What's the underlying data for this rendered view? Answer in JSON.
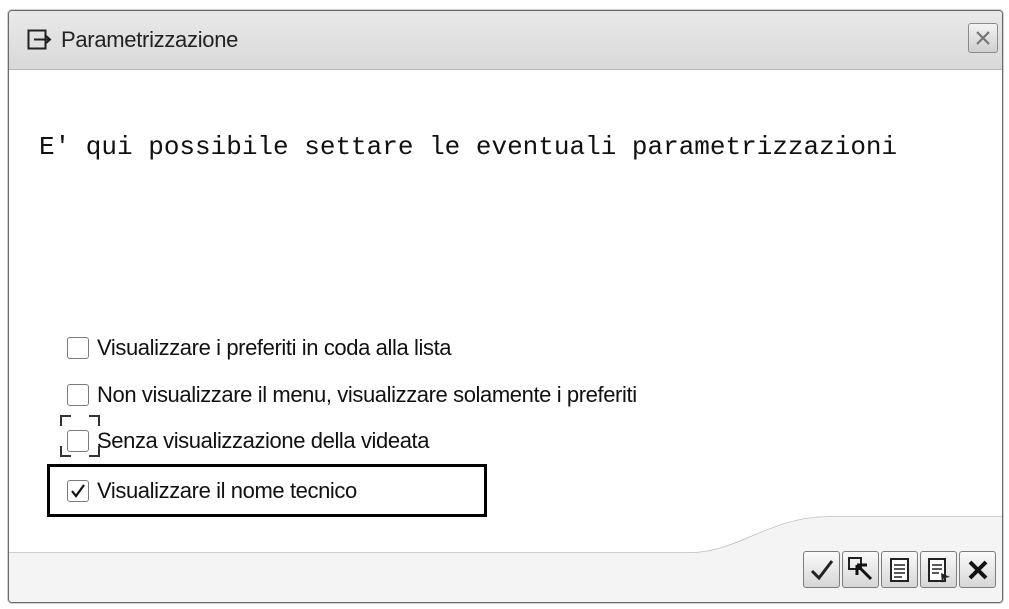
{
  "window": {
    "title": "Parametrizzazione"
  },
  "message": "E' qui possibile settare le eventuali parametrizzazioni",
  "options": [
    {
      "label": "Visualizzare i preferiti in coda alla lista",
      "checked": false
    },
    {
      "label": "Non visualizzare il menu, visualizzare solamente i preferiti",
      "checked": false
    },
    {
      "label": "Senza visualizzazione della videata",
      "checked": false
    },
    {
      "label": "Visualizzare il nome tecnico",
      "checked": true
    }
  ],
  "toolbar": {
    "buttons": [
      "check-icon",
      "select-arrow-icon",
      "document-icon",
      "document-arrow-icon",
      "cancel-icon"
    ]
  },
  "colors": {
    "titlebar": "#dcdcdc",
    "highlight_border": "#000000"
  }
}
